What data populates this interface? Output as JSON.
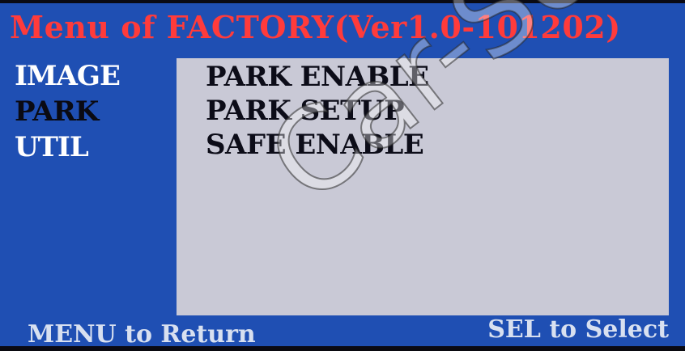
{
  "title": {
    "prefix": "Menu of",
    "main": "FACTORY(Ver1.0-101202)"
  },
  "side_menu": {
    "items": [
      {
        "label": "IMAGE",
        "selected": false
      },
      {
        "label": "PARK",
        "selected": true
      },
      {
        "label": "UTIL",
        "selected": false
      }
    ]
  },
  "content": {
    "items": [
      {
        "label": "PARK ENABLE"
      },
      {
        "label": "PARK SETUP"
      },
      {
        "label": "SAFE ENABLE"
      }
    ]
  },
  "footer": {
    "left_hint": "MENU to Return",
    "right_hint": "SEL to Select"
  },
  "watermark": {
    "text": "Car-So"
  },
  "colors": {
    "background": "#1f4fb3",
    "title": "#ff3b3b",
    "panel": "#c9c9d6",
    "menu_text": "#ffffff",
    "selected_text": "#0a0a12"
  }
}
